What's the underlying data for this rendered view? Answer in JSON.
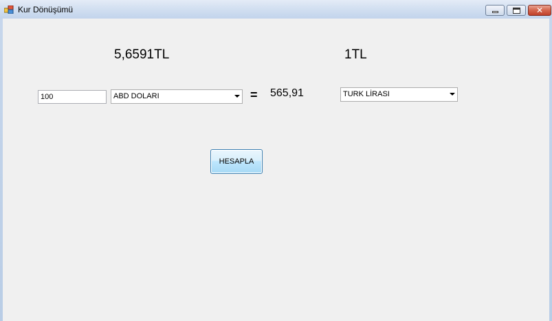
{
  "window": {
    "title": "Kur Dönüşümü",
    "controls": {
      "close_glyph": "✕"
    }
  },
  "rates": {
    "left": "5,6591TL",
    "right": "1TL"
  },
  "converter": {
    "amount_value": "100",
    "from_currency": "ABD DOLARI",
    "equals": "=",
    "result": "565,91",
    "to_currency": "TURK LİRASI"
  },
  "actions": {
    "calculate_label": "HESAPLA"
  },
  "icons": {
    "app": "app-window-icon",
    "minimize": "minimize-icon",
    "maximize": "maximize-icon",
    "close": "close-icon",
    "dropdown": "chevron-down-icon"
  },
  "colors": {
    "close_button": "#c0402a",
    "button_border": "#3c7fb1",
    "client_bg": "#f0f0f0"
  }
}
